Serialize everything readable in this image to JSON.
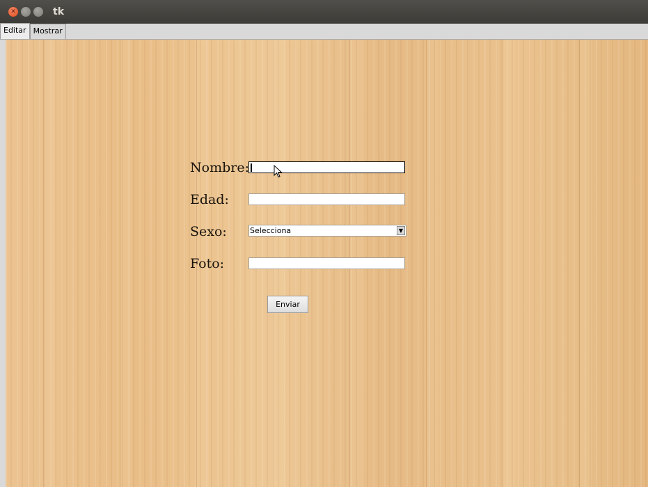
{
  "window": {
    "title": "tk"
  },
  "tabs": [
    {
      "label": "Editar"
    },
    {
      "label": "Mostrar"
    }
  ],
  "form": {
    "nombre_label": "Nombre:",
    "nombre_value": "",
    "edad_label": "Edad:",
    "edad_value": "",
    "sexo_label": "Sexo:",
    "sexo_selected": "Selecciona",
    "foto_label": "Foto:",
    "foto_value": "",
    "submit_label": "Enviar"
  },
  "colors": {
    "titlebar": "#3c3b37",
    "close_button": "#df4a16",
    "wood": "#e6bd87"
  }
}
